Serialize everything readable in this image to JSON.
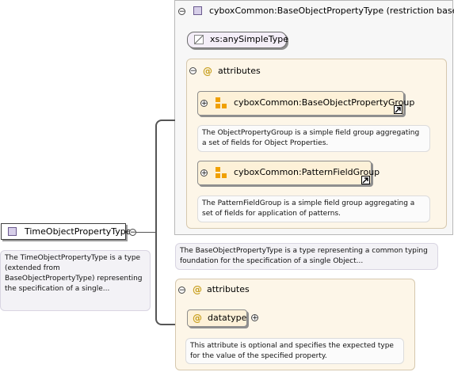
{
  "root": {
    "type_label": "TimeObjectPropertyType",
    "documentation": "The TimeObjectPropertyType is a type (extended from BaseObjectPropertyType) representing the specification of a single..."
  },
  "base": {
    "title": "cyboxCommon:BaseObjectPropertyType (restriction base)",
    "simple_type": "xs:anySimpleType",
    "attributes_label": "attributes",
    "groups": [
      {
        "label": "cyboxCommon:BaseObjectPropertyGroup",
        "documentation": "The ObjectPropertyGroup is a simple field group aggregating a set of fields for Object Properties."
      },
      {
        "label": "cyboxCommon:PatternFieldGroup",
        "documentation": "The PatternFieldGroup is a simple field group aggregating a set of fields for application of patterns."
      }
    ],
    "documentation": "The BaseObjectPropertyType is a type representing a common typing foundation for the specification of a single Object..."
  },
  "own_attributes": {
    "label": "attributes",
    "attribute": "datatype",
    "documentation": "This attribute is optional and specifies the expected type for the value of the specified property."
  },
  "symbols": {
    "collapse": "⊖",
    "expand": "⊕",
    "attribute_marker": "@"
  },
  "icons": [
    "complex-type-icon",
    "simple-type-icon",
    "attribute-group-icon",
    "link-arrow-icon",
    "collapse-icon",
    "expand-icon"
  ],
  "colors": {
    "type_square": "#d7cfe9",
    "attribute_marker": "#c8a020",
    "group_fill": "#fdf1d8",
    "group_icon": "#f0a000",
    "attributes_panel": "#fdf6e8"
  }
}
